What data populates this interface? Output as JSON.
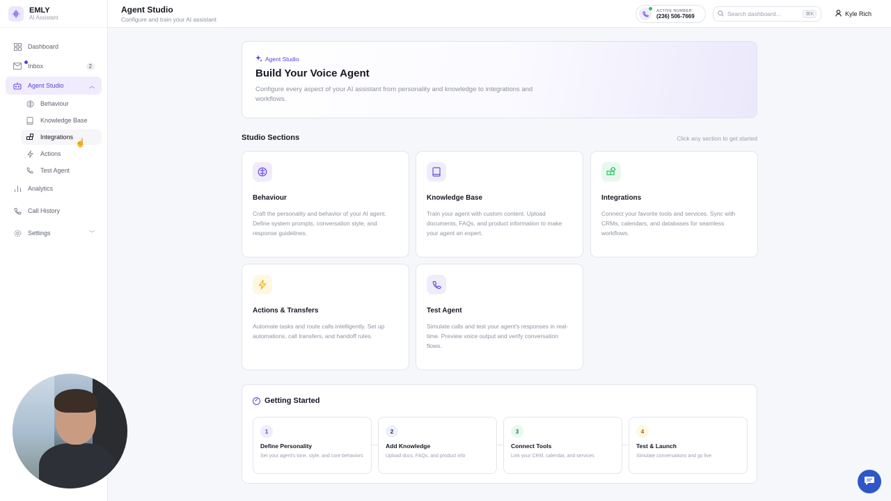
{
  "brand": {
    "name": "EMLY",
    "subtitle": "AI Assistant"
  },
  "sidebar": {
    "items": [
      {
        "label": "Dashboard"
      },
      {
        "label": "Inbox",
        "badge": "2"
      },
      {
        "label": "Agent Studio"
      },
      {
        "label": "Analytics"
      },
      {
        "label": "Call History"
      },
      {
        "label": "Settings"
      }
    ],
    "sub_items": [
      {
        "label": "Behaviour"
      },
      {
        "label": "Knowledge Base"
      },
      {
        "label": "Integrations"
      },
      {
        "label": "Actions"
      },
      {
        "label": "Test Agent"
      }
    ]
  },
  "header": {
    "title": "Agent Studio",
    "subtitle": "Configure and train your AI assistant",
    "phone_label": "ACTIVE NUMBER",
    "phone_number": "(236) 506-7669",
    "search_placeholder": "Search dashboard...",
    "search_shortcut": "⌘K",
    "user_name": "Kyle Rich"
  },
  "hero": {
    "tag": "Agent Studio",
    "title": "Build Your Voice Agent",
    "description": "Configure every aspect of your AI assistant from personality and knowledge to integrations and workflows."
  },
  "sections": {
    "title": "Studio Sections",
    "hint": "Click any section to get started",
    "cards": [
      {
        "title": "Behaviour",
        "description": "Craft the personality and behavior of your AI agent. Define system prompts, conversation style, and response guidelines.",
        "icon": "brain-icon",
        "color": "#6a4be0"
      },
      {
        "title": "Knowledge Base",
        "description": "Train your agent with custom content. Upload documents, FAQs, and product information to make your agent an expert.",
        "icon": "book-icon",
        "color": "#6a4be0"
      },
      {
        "title": "Integrations",
        "description": "Connect your favorite tools and services. Sync with CRMs, calendars, and databases for seamless workflows.",
        "icon": "puzzle-icon",
        "color": "#22c55e"
      },
      {
        "title": "Actions & Transfers",
        "description": "Automate tasks and route calls intelligently. Set up automations, call transfers, and handoff rules.",
        "icon": "bolt-icon",
        "color": "#f5b301"
      },
      {
        "title": "Test Agent",
        "description": "Simulate calls and test your agent's responses in real-time. Preview voice output and verify conversation flows.",
        "icon": "phone-icon",
        "color": "#6a4be0"
      }
    ]
  },
  "getting_started": {
    "title": "Getting Started",
    "steps": [
      {
        "num": "1",
        "title": "Define Personality",
        "description": "Set your agent's tone, style, and core behaviors"
      },
      {
        "num": "2",
        "title": "Add Knowledge",
        "description": "Upload docs, FAQs, and product info"
      },
      {
        "num": "3",
        "title": "Connect Tools",
        "description": "Link your CRM, calendar, and services"
      },
      {
        "num": "4",
        "title": "Test & Launch",
        "description": "Simulate conversations and go live"
      }
    ]
  },
  "colors": {
    "accent": "#5d3fd3",
    "chat_button": "#2f56c9"
  }
}
